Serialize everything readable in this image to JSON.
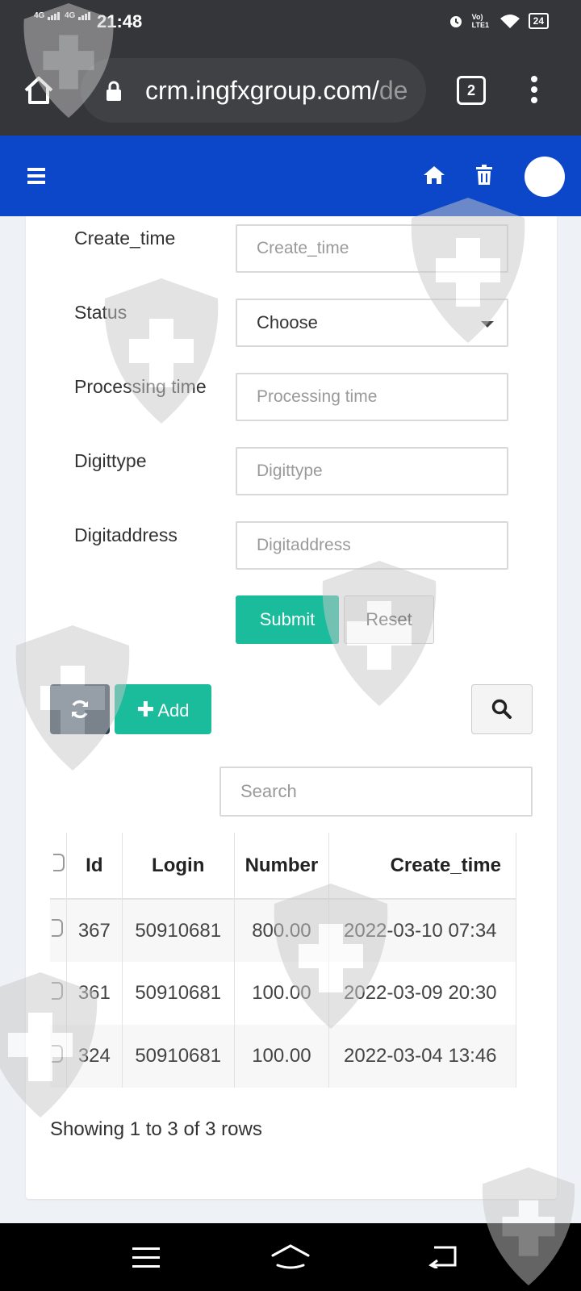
{
  "status_bar": {
    "time": "21:48",
    "signal_1": "4G",
    "signal_2": "4G",
    "volte": "Vo) LTE1",
    "battery": "24"
  },
  "browser": {
    "url_main": "crm.ingfxgroup.com/",
    "url_rest": "de",
    "tab_count": "2"
  },
  "form": {
    "create_time": {
      "label": "Create_time",
      "placeholder": "Create_time"
    },
    "status": {
      "label": "Status",
      "selected": "Choose"
    },
    "processing_time": {
      "label": "Processing time",
      "placeholder": "Processing time"
    },
    "digittype": {
      "label": "Digittype",
      "placeholder": "Digittype"
    },
    "digitaddress": {
      "label": "Digitaddress",
      "placeholder": "Digitaddress"
    },
    "submit_label": "Submit",
    "reset_label": "Reset"
  },
  "toolbar": {
    "add_label": "Add",
    "search_placeholder": "Search"
  },
  "table": {
    "headers": [
      "Id",
      "Login",
      "Number",
      "Create_time"
    ],
    "rows": [
      {
        "id": "367",
        "login": "50910681",
        "number": "800.00",
        "create_time": "2022-03-10 07:34"
      },
      {
        "id": "361",
        "login": "50910681",
        "number": "100.00",
        "create_time": "2022-03-09 20:30"
      },
      {
        "id": "324",
        "login": "50910681",
        "number": "100.00",
        "create_time": "2022-03-04 13:46"
      }
    ],
    "footer": "Showing 1 to 3 of 3 rows"
  },
  "colors": {
    "browser_bg": "#353639",
    "header_blue": "#0d47c9",
    "accent_teal": "#1abc9c",
    "dark_button": "#2c3e50"
  }
}
